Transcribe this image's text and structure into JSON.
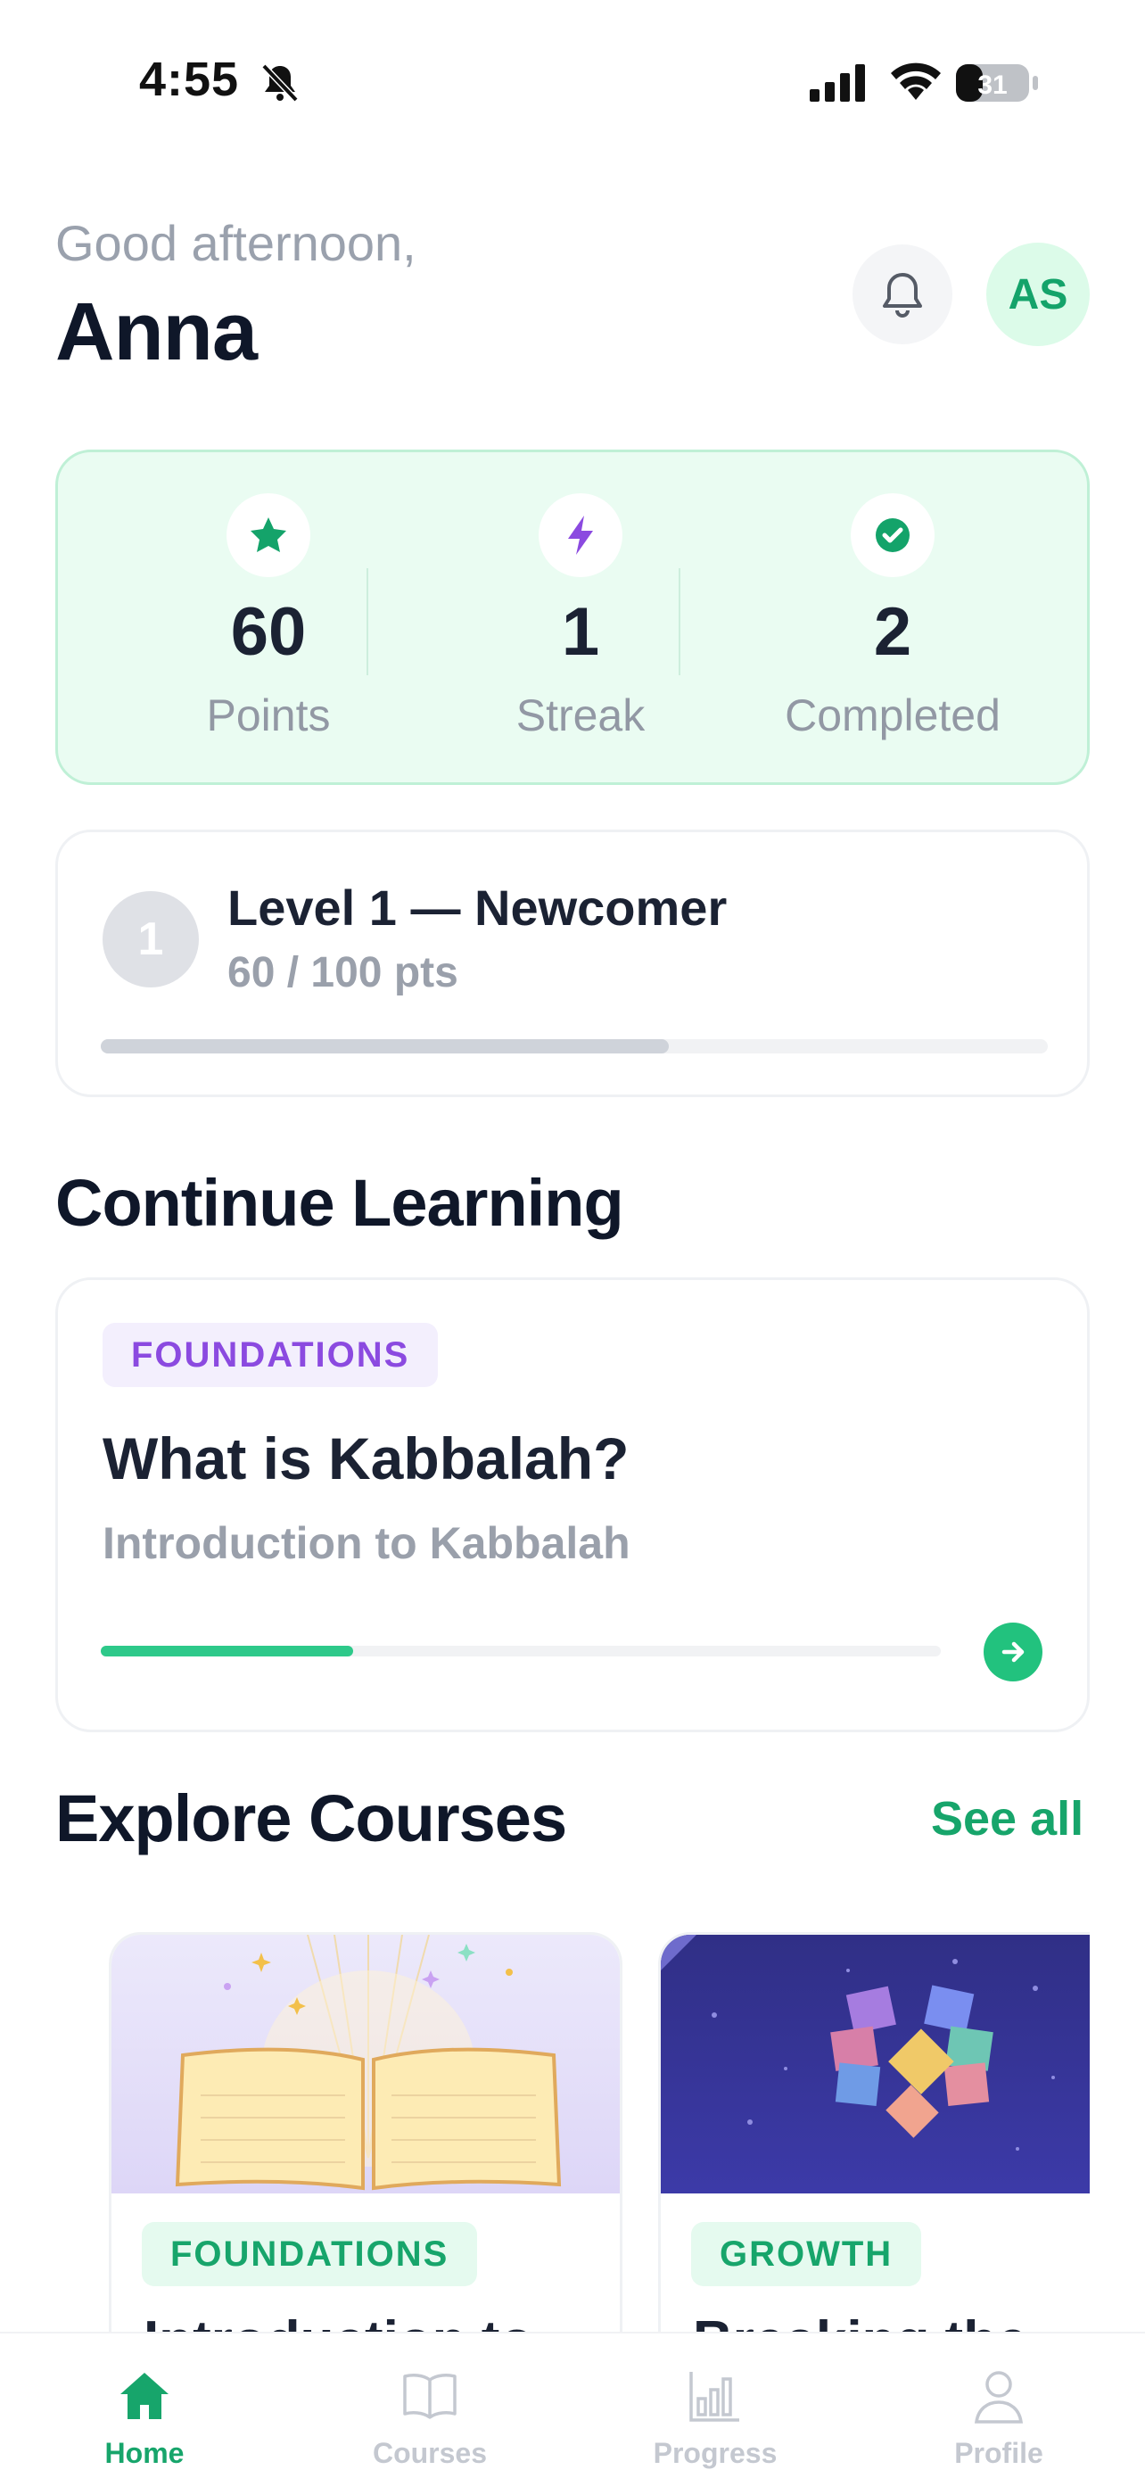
{
  "status_bar": {
    "time": "4:55",
    "battery": "31"
  },
  "header": {
    "greeting": "Good afternoon,",
    "name": "Anna",
    "avatar_initials": "AS"
  },
  "stats": [
    {
      "icon": "star-icon",
      "value": "60",
      "label": "Points",
      "color": "#14a36a"
    },
    {
      "icon": "lightning-icon",
      "value": "1",
      "label": "Streak",
      "color": "#8b4ae0"
    },
    {
      "icon": "check-circle-icon",
      "value": "2",
      "label": "Completed",
      "color": "#14a36a"
    }
  ],
  "level": {
    "number": "1",
    "title": "Level 1 — Newcomer",
    "points": "60 / 100 pts",
    "progress": 0.6
  },
  "continue": {
    "section_title": "Continue Learning",
    "tag": "FOUNDATIONS",
    "title": "What is Kabbalah?",
    "subtitle": "Introduction to Kabbalah",
    "progress": 0.3
  },
  "explore": {
    "section_title": "Explore Courses",
    "see_all": "See all",
    "courses": [
      {
        "tag": "FOUNDATIONS",
        "title": "Introduction to"
      },
      {
        "tag": "GROWTH",
        "title": "Breaking the"
      }
    ]
  },
  "tabs": [
    {
      "label": "Home",
      "icon": "home-icon",
      "active": true
    },
    {
      "label": "Courses",
      "icon": "book-icon",
      "active": false
    },
    {
      "label": "Progress",
      "icon": "bar-chart-icon",
      "active": false
    },
    {
      "label": "Profile",
      "icon": "person-icon",
      "active": false
    }
  ],
  "colors": {
    "accent": "#17a56b",
    "purple": "#8b4ae0",
    "card_mint": "#eafcf2"
  }
}
